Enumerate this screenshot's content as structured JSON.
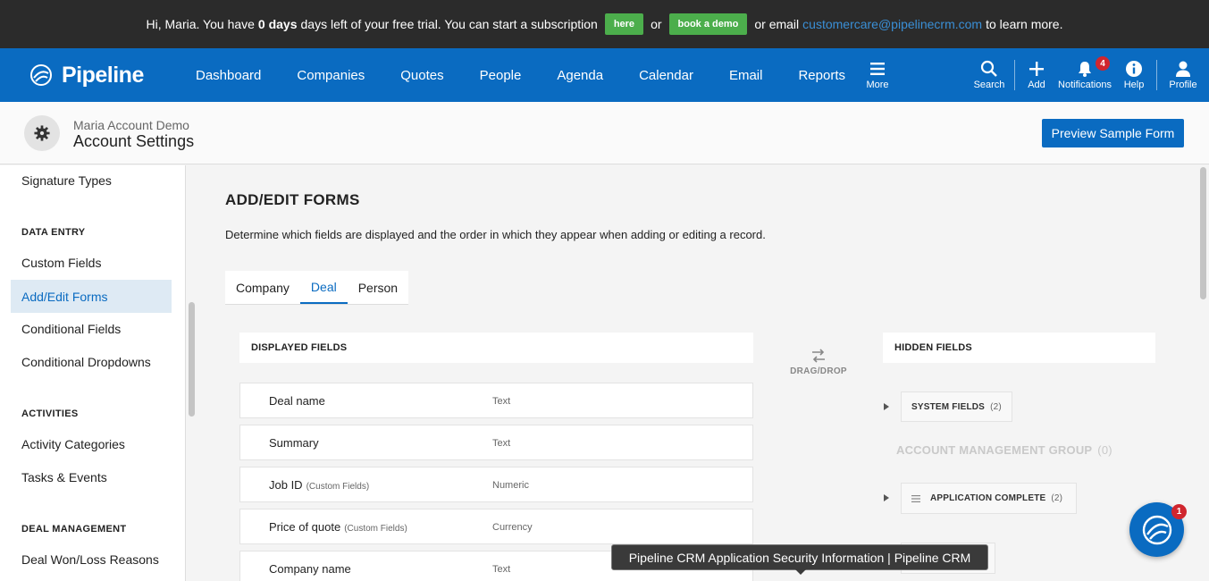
{
  "banner": {
    "greeting": "Hi, Maria. You have",
    "days": "0 days",
    "mid": "days left of your free trial. You can start a subscription",
    "here_label": "here",
    "or1": "or",
    "demo_label": "book a demo",
    "or2": "or email",
    "email": "customercare@pipelinecrm.com",
    "tail": "to learn more."
  },
  "nav": {
    "brand": "Pipeline",
    "links": [
      "Dashboard",
      "Companies",
      "Quotes",
      "People",
      "Agenda",
      "Calendar",
      "Email",
      "Reports"
    ],
    "more": "More",
    "search": "Search",
    "add": "Add",
    "notifications": "Notifications",
    "notification_count": "4",
    "help": "Help",
    "profile": "Profile"
  },
  "header": {
    "account": "Maria Account Demo",
    "title": "Account Settings",
    "preview_button": "Preview Sample Form"
  },
  "sidebar": {
    "top_item": "Signature Types",
    "sections": [
      {
        "title": "DATA ENTRY",
        "items": [
          "Custom Fields",
          "Add/Edit Forms",
          "Conditional Fields",
          "Conditional Dropdowns"
        ]
      },
      {
        "title": "ACTIVITIES",
        "items": [
          "Activity Categories",
          "Tasks & Events"
        ]
      },
      {
        "title": "DEAL MANAGEMENT",
        "items": [
          "Deal Won/Loss Reasons"
        ]
      }
    ],
    "active": "Add/Edit Forms"
  },
  "main": {
    "title": "ADD/EDIT FORMS",
    "description": "Determine which fields are displayed and the order in which they appear when adding or editing a record.",
    "tabs": [
      "Company",
      "Deal",
      "Person"
    ],
    "active_tab": "Deal",
    "displayed_header": "DISPLAYED FIELDS",
    "drag_label": "DRAG/DROP",
    "hidden_header": "HIDDEN FIELDS",
    "fields": [
      {
        "name": "Deal name",
        "tag": "",
        "type": "Text"
      },
      {
        "name": "Summary",
        "tag": "",
        "type": "Text"
      },
      {
        "name": "Job ID",
        "tag": "(Custom Fields)",
        "type": "Numeric"
      },
      {
        "name": "Price of quote",
        "tag": "(Custom Fields)",
        "type": "Currency"
      },
      {
        "name": "Company name",
        "tag": "",
        "type": "Text"
      }
    ],
    "hidden_groups": [
      {
        "name": "SYSTEM FIELDS",
        "count": "(2)"
      },
      {
        "name": "ACCOUNT MANAGEMENT GROUP",
        "count": "(0)"
      },
      {
        "name": "APPLICATION COMPLETE",
        "count": "(2)"
      }
    ]
  },
  "tooltip": "Pipeline CRM Application Security Information | Pipeline CRM",
  "chat_badge": "1",
  "colors": {
    "brand": "#0a6bc1",
    "banner": "#2b2b2b",
    "green": "#4cae4c",
    "badge": "#d0262e"
  }
}
